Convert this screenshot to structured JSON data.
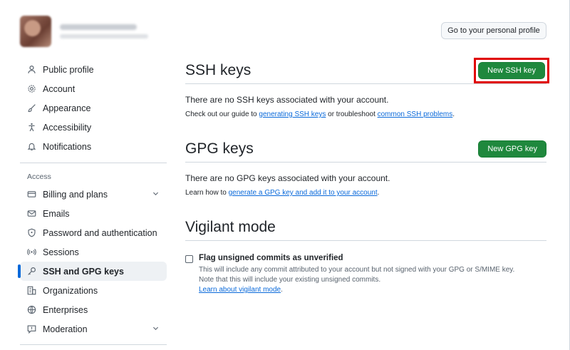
{
  "header": {
    "profile_button": "Go to your personal profile"
  },
  "sidebar": {
    "items": [
      {
        "label": "Public profile",
        "icon": "person-icon"
      },
      {
        "label": "Account",
        "icon": "gear-icon"
      },
      {
        "label": "Appearance",
        "icon": "paintbrush-icon"
      },
      {
        "label": "Accessibility",
        "icon": "accessibility-icon"
      },
      {
        "label": "Notifications",
        "icon": "bell-icon"
      }
    ],
    "access_heading": "Access",
    "access_items": [
      {
        "label": "Billing and plans",
        "icon": "credit-card-icon",
        "expandable": true
      },
      {
        "label": "Emails",
        "icon": "mail-icon"
      },
      {
        "label": "Password and authentication",
        "icon": "shield-lock-icon"
      },
      {
        "label": "Sessions",
        "icon": "broadcast-icon"
      },
      {
        "label": "SSH and GPG keys",
        "icon": "key-icon",
        "active": true
      },
      {
        "label": "Organizations",
        "icon": "organization-icon"
      },
      {
        "label": "Enterprises",
        "icon": "globe-icon"
      },
      {
        "label": "Moderation",
        "icon": "report-icon",
        "expandable": true
      }
    ]
  },
  "ssh": {
    "title": "SSH keys",
    "button": "New SSH key",
    "empty": "There are no SSH keys associated with your account.",
    "hint_pre": "Check out our guide to ",
    "hint_link1": "generating SSH keys",
    "hint_mid": " or troubleshoot ",
    "hint_link2": "common SSH problems",
    "hint_post": "."
  },
  "gpg": {
    "title": "GPG keys",
    "button": "New GPG key",
    "empty": "There are no GPG keys associated with your account.",
    "hint_pre": "Learn how to ",
    "hint_link": "generate a GPG key and add it to your account",
    "hint_post": "."
  },
  "vigilant": {
    "title": "Vigilant mode",
    "checkbox_label": "Flag unsigned commits as unverified",
    "desc_line1": "This will include any commit attributed to your account but not signed with your GPG or S/MIME key.",
    "desc_line2": "Note that this will include your existing unsigned commits.",
    "learn_link": "Learn about vigilant mode",
    "learn_post": "."
  },
  "colors": {
    "primary_green": "#1f883d",
    "link_blue": "#0969da",
    "highlight_red": "#e00000"
  }
}
